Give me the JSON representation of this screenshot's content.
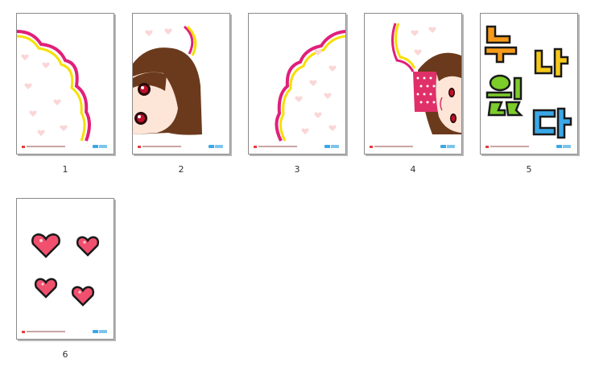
{
  "thumbnails": [
    {
      "page_number": "1",
      "content": "speech-bubble-left-half"
    },
    {
      "page_number": "2",
      "content": "girl-face-left-half"
    },
    {
      "page_number": "3",
      "content": "speech-bubble-right-half"
    },
    {
      "page_number": "4",
      "content": "girl-face-right-half"
    },
    {
      "page_number": "5",
      "content": "korean-letters"
    },
    {
      "page_number": "6",
      "content": "hearts"
    }
  ],
  "colors": {
    "bubble_outer": "#e0207a",
    "bubble_inner": "#f5e000",
    "heart_fill": "#f0506e",
    "hair": "#6b3a1c",
    "skin": "#fde6d8"
  }
}
